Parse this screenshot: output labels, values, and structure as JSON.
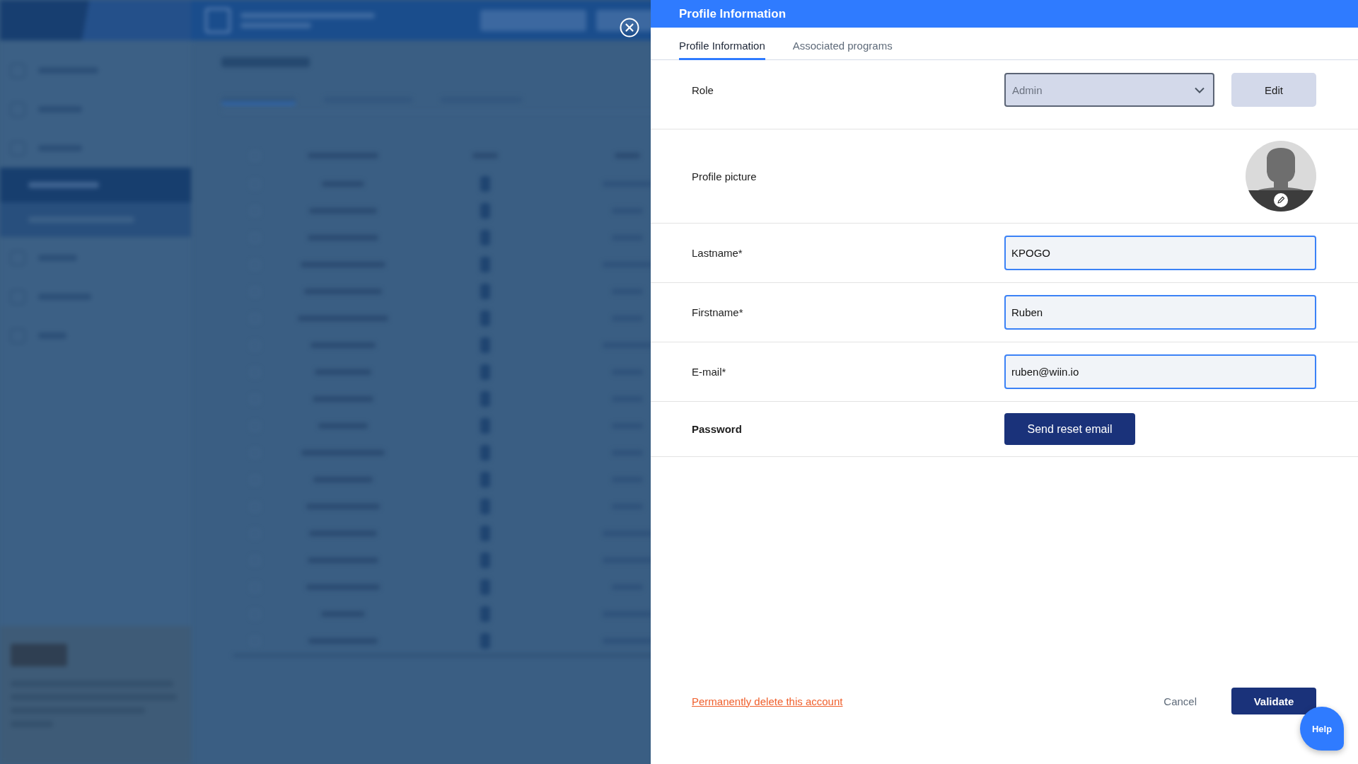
{
  "panel": {
    "title": "Profile Information"
  },
  "tabs": [
    {
      "label": "Profile Information",
      "selected": true
    },
    {
      "label": "Associated programs",
      "selected": false
    }
  ],
  "rows": [
    {
      "kind": "select",
      "label": "Role",
      "value": "Admin",
      "disabled": true,
      "button": "Edit"
    },
    {
      "kind": "avatar",
      "label": "Profile picture"
    },
    {
      "kind": "input",
      "label": "Lastname*",
      "value": "KPOGO"
    },
    {
      "kind": "input",
      "label": "Firstname*",
      "value": "Ruben"
    },
    {
      "kind": "input",
      "label": "E-mail*",
      "value": "ruben@wiin.io"
    },
    {
      "kind": "action",
      "label": "Password",
      "button": "Send reset email"
    }
  ],
  "footer": {
    "delete_link": "Permanently delete this account",
    "cancel": "Cancel",
    "validate": "Validate"
  },
  "help": {
    "label": "Help"
  }
}
